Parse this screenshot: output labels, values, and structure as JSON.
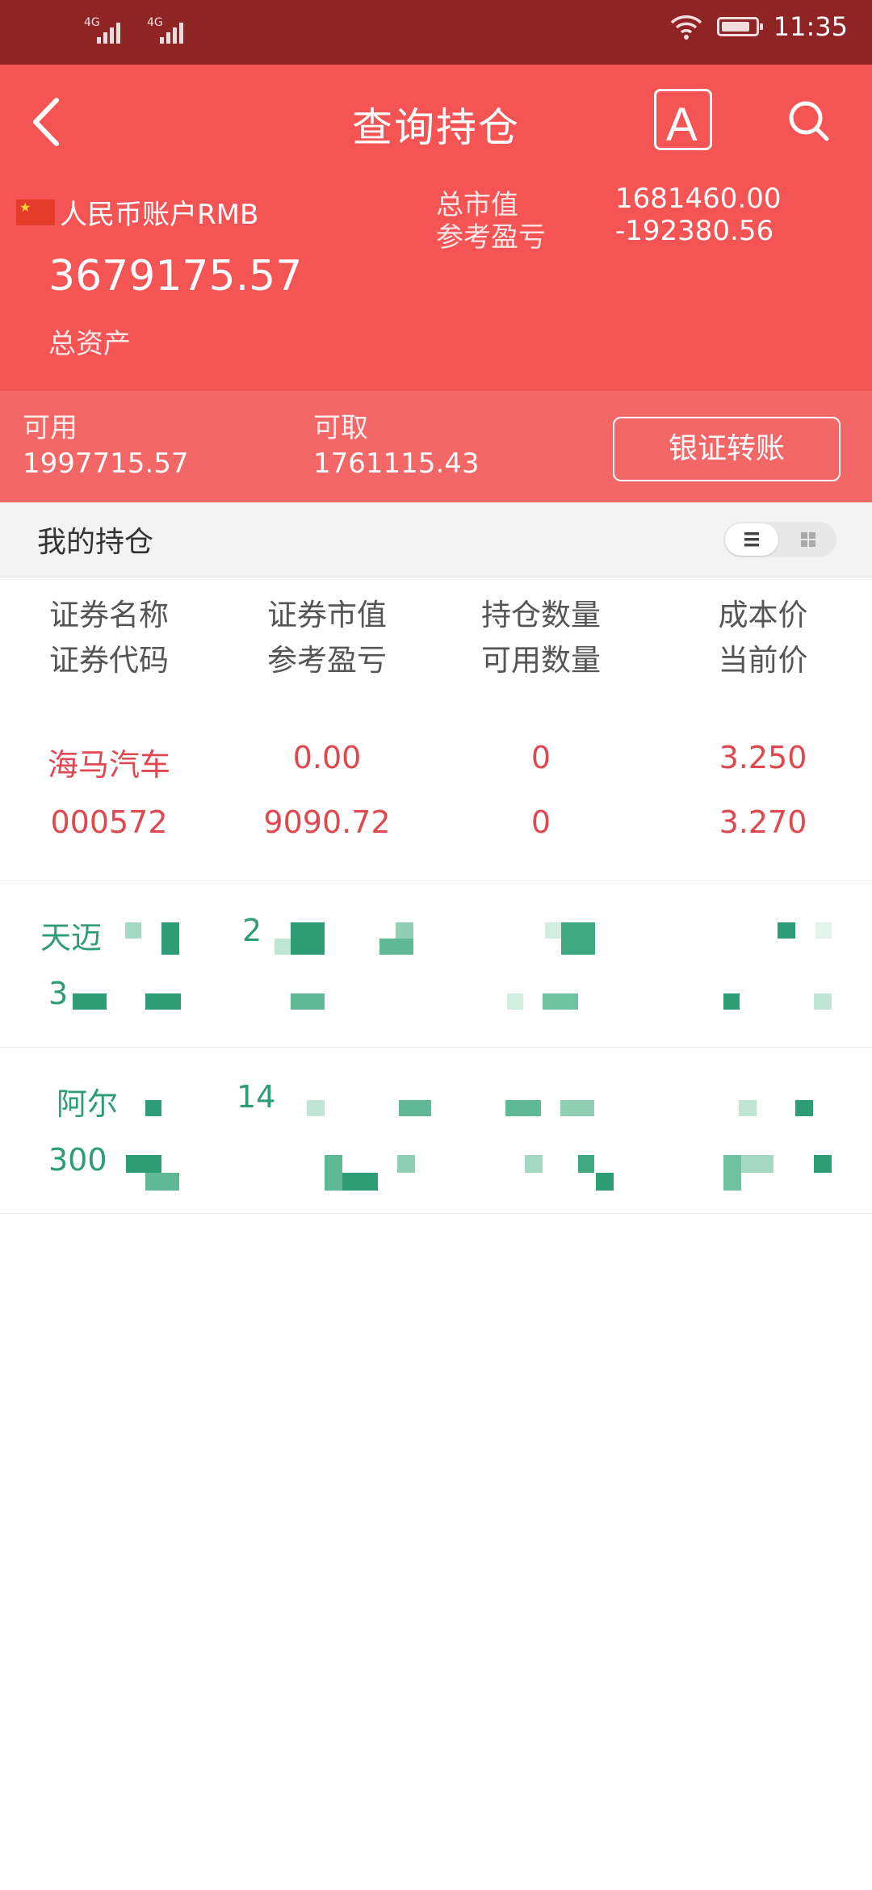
{
  "status_bar": {
    "time": "11:35",
    "signal_labels": [
      "4G",
      "4G"
    ]
  },
  "header": {
    "title": "查询持仓",
    "font_button_label": "A",
    "account_label": "人民币账户RMB",
    "total_assets_value": "3679175.57",
    "total_assets_label": "总资产",
    "market_value_label": "总市值",
    "market_value": "1681460.00",
    "pnl_label": "参考盈亏",
    "pnl_value": "-192380.56"
  },
  "balances": {
    "available_label": "可用",
    "available_value": "1997715.57",
    "withdrawable_label": "可取",
    "withdrawable_value": "1761115.43",
    "transfer_button": "银证转账"
  },
  "holdings": {
    "section_title": "我的持仓",
    "columns": [
      {
        "line1": "证券名称",
        "line2": "证券代码"
      },
      {
        "line1": "证券市值",
        "line2": "参考盈亏"
      },
      {
        "line1": "持仓数量",
        "line2": "可用数量"
      },
      {
        "line1": "成本价",
        "line2": "当前价"
      }
    ],
    "rows": [
      {
        "name": "海马汽车",
        "code": "000572",
        "market_value": "0.00",
        "pnl": "9090.72",
        "qty": "0",
        "avail_qty": "0",
        "cost": "3.250",
        "price": "3.270"
      },
      {
        "name": "天迈",
        "code": "3",
        "market_value": "2"
      },
      {
        "name": "阿尔",
        "code": "300",
        "market_value": "14"
      }
    ]
  },
  "colors": {
    "status_bar": "#8e2423",
    "header": "#f45454",
    "strip": "#f36767",
    "loss_red": "#e0484f",
    "gain_green": "#2e9c74"
  },
  "icons": [
    "back-arrow-icon",
    "font-size-icon",
    "search-icon",
    "china-flag-icon",
    "wifi-icon",
    "battery-icon",
    "list-view-icon",
    "grid-view-icon"
  ]
}
